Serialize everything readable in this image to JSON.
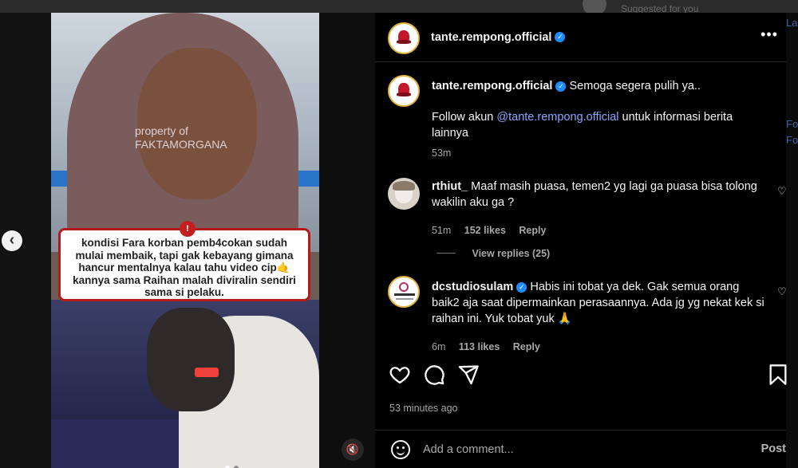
{
  "background_feed": {
    "suggested_text": "Suggested for you"
  },
  "peek_text": [
    "Fol",
    "Fol",
    "Lai"
  ],
  "media": {
    "watermark": [
      "property of",
      "FAKTAMORGANA"
    ],
    "caption": "kondisi Fara korban pemb4cokan sudah mulai membaik, tapi gak kebayang gimana hancur mentalnya kalau tahu video cip🤙kannya sama Raihan malah diviralin sendiri sama si pelaku.",
    "badge": "!",
    "carousel_dots": 2,
    "active_dot": 1
  },
  "header": {
    "username": "tante.rempong.official",
    "more_label": "•••"
  },
  "post_caption": {
    "username": "tante.rempong.official",
    "text": "Semoga segera pulih ya..",
    "follow_prefix": "Follow akun ",
    "follow_mention": "@tante.rempong.official",
    "follow_suffix": " untuk informasi berita lainnya",
    "time": "53m"
  },
  "comments": [
    {
      "username": "rthiut_",
      "text": "Maaf masih puasa, temen2 yg lagi ga puasa bisa tolong wakilin aku ga ?",
      "time": "51m",
      "likes": "152 likes",
      "reply": "Reply",
      "view_replies": "View replies (25)"
    },
    {
      "username": "dcstudiosulam",
      "text": "Habis ini tobat ya dek. Gak semua orang baik2 aja saat dipermainkan perasaannya. Ada jg yg nekat kek si raihan ini. Yuk tobat yuk 🙏",
      "time": "6m",
      "likes": "113 likes",
      "reply": "Reply"
    }
  ],
  "actions": {
    "timestamp": "53 minutes ago"
  },
  "composer": {
    "placeholder": "Add a comment...",
    "post_label": "Post"
  },
  "colors": {
    "link": "#8ca6ff",
    "verified": "#1f8cff",
    "caption_border": "#b31b1b"
  }
}
